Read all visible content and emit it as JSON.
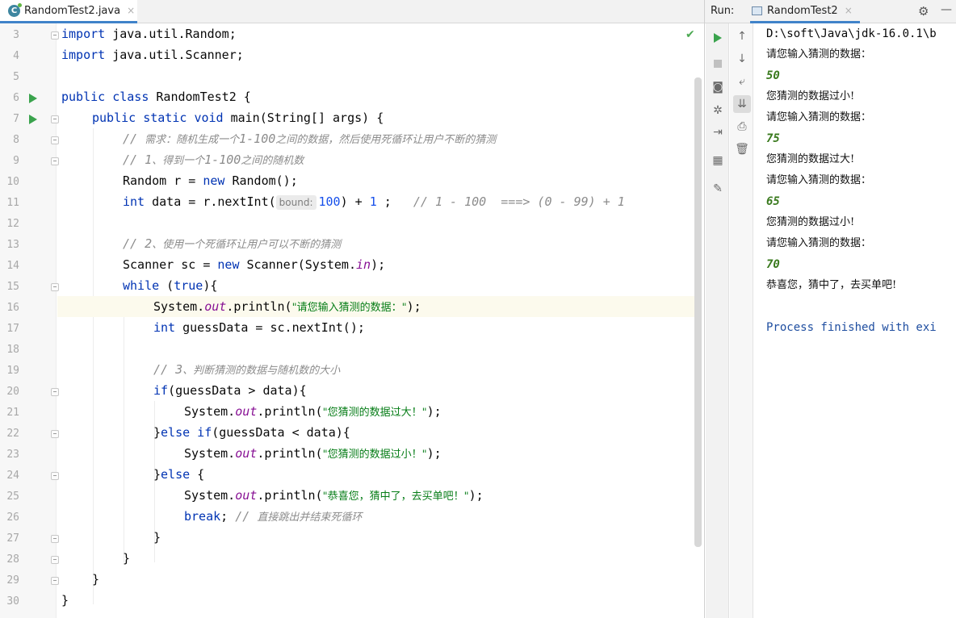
{
  "editor": {
    "tab": {
      "file_name": "RandomTest2.java",
      "icon": "class-icon",
      "close": "×"
    },
    "status_icon": "✔",
    "line_numbers": [
      "3",
      "4",
      "5",
      "6",
      "7",
      "8",
      "9",
      "10",
      "11",
      "12",
      "13",
      "14",
      "15",
      "16",
      "17",
      "18",
      "19",
      "20",
      "21",
      "22",
      "23",
      "24",
      "25",
      "26",
      "27",
      "28",
      "29",
      "30"
    ],
    "current_line": "16",
    "code": {
      "l3": {
        "kw": "import",
        "rest": " java.util.Random;"
      },
      "l4": {
        "kw": "import",
        "rest": " java.util.Scanner;"
      },
      "l6": {
        "kw1": "public",
        "kw2": "class",
        "rest": " RandomTest2 {"
      },
      "l7": {
        "kw1": "public",
        "kw2": "static",
        "kw3": "void",
        "rest": " main(String[] args) {"
      },
      "l8": {
        "slash": "// ",
        "zh1": "需求：随机生成一个",
        "num": "1-100",
        "zh2": "之间的数据，然后使用死循环让用户不断的猜测"
      },
      "l9": {
        "slash": "// 1",
        "zh1": "、得到一个",
        "num": "1-100",
        "zh2": "之间的随机数"
      },
      "l10": {
        "p1": "Random r = ",
        "kw": "new",
        "p2": " Random();"
      },
      "l11": {
        "kw": "int",
        "p1": " data = r.nextInt(",
        "hint": "bound:",
        "num1": "100",
        "p2": ") + ",
        "num2": "1",
        "p3": " ;   ",
        "comment": "// 1 - 100  ===> (0 - 99) + 1"
      },
      "l13": {
        "slash": "// 2",
        "zh": "、使用一个死循环让用户可以不断的猜测"
      },
      "l14": {
        "p1": "Scanner sc = ",
        "kw": "new",
        "p2": " Scanner(System.",
        "field": "in",
        "p3": ");"
      },
      "l15": {
        "kw": "while",
        "p1": " (",
        "kw2": "true",
        "p2": "){"
      },
      "l16": {
        "p1": "System.",
        "field": "out",
        "p2": ".println(",
        "str": "\"请您输入猜测的数据：\"",
        "p3": ");"
      },
      "l17": {
        "kw": "int",
        "p1": " guessData = sc.nextInt();"
      },
      "l19": {
        "slash": "// 3",
        "zh": "、判断猜测的数据与随机数的大小"
      },
      "l20": {
        "kw": "if",
        "p1": "(guessData > data){"
      },
      "l21": {
        "p1": "System.",
        "field": "out",
        "p2": ".println(",
        "str": "\"您猜测的数据过大！\"",
        "p3": ");"
      },
      "l22": {
        "p0": "}",
        "kw": "else if",
        "p1": "(guessData < data){"
      },
      "l23": {
        "p1": "System.",
        "field": "out",
        "p2": ".println(",
        "str": "\"您猜测的数据过小！\"",
        "p3": ");"
      },
      "l24": {
        "p0": "}",
        "kw": "else",
        "p1": " {"
      },
      "l25": {
        "p1": "System.",
        "field": "out",
        "p2": ".println(",
        "str": "\"恭喜您，猜中了，去买单吧！\"",
        "p3": ");"
      },
      "l26": {
        "kw": "break",
        "p1": "; ",
        "slash": "// ",
        "zh": "直接跳出并结束死循环"
      },
      "l27": {
        "p1": "}"
      },
      "l28": {
        "p1": "}"
      },
      "l29": {
        "p1": "}"
      },
      "l30": {
        "p1": "}"
      }
    }
  },
  "run": {
    "label": "Run:",
    "tab_name": "RandomTest2",
    "tab_close": "×",
    "icons": {
      "settings": "gear-icon",
      "minimize": "minimize-icon"
    },
    "console": [
      {
        "type": "path",
        "text": "D:\\soft\\Java\\jdk-16.0.1\\b"
      },
      {
        "type": "cn",
        "text": "请您输入猜测的数据："
      },
      {
        "type": "input",
        "text": "50"
      },
      {
        "type": "cn",
        "text": "您猜测的数据过小!"
      },
      {
        "type": "cn",
        "text": "请您输入猜测的数据："
      },
      {
        "type": "input",
        "text": "75"
      },
      {
        "type": "cn",
        "text": "您猜测的数据过大!"
      },
      {
        "type": "cn",
        "text": "请您输入猜测的数据："
      },
      {
        "type": "input",
        "text": "65"
      },
      {
        "type": "cn",
        "text": "您猜测的数据过小!"
      },
      {
        "type": "cn",
        "text": "请您输入猜测的数据："
      },
      {
        "type": "input",
        "text": "70"
      },
      {
        "type": "cn",
        "text": "恭喜您，猜中了，去买单吧!"
      },
      {
        "type": "blank",
        "text": ""
      },
      {
        "type": "finished",
        "text": "Process finished with exi"
      }
    ]
  }
}
